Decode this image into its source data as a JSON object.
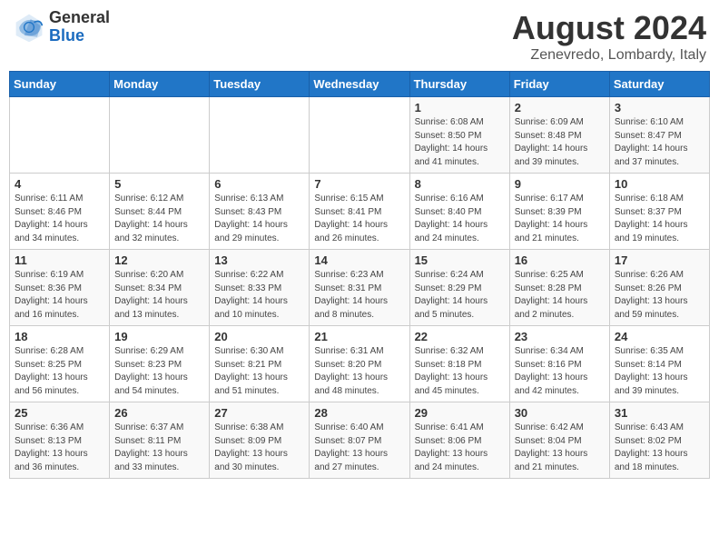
{
  "header": {
    "logo_general": "General",
    "logo_blue": "Blue",
    "main_title": "August 2024",
    "sub_title": "Zenevredo, Lombardy, Italy"
  },
  "days_of_week": [
    "Sunday",
    "Monday",
    "Tuesday",
    "Wednesday",
    "Thursday",
    "Friday",
    "Saturday"
  ],
  "weeks": [
    [
      {
        "day": "",
        "sunrise": "",
        "sunset": "",
        "daylight": ""
      },
      {
        "day": "",
        "sunrise": "",
        "sunset": "",
        "daylight": ""
      },
      {
        "day": "",
        "sunrise": "",
        "sunset": "",
        "daylight": ""
      },
      {
        "day": "",
        "sunrise": "",
        "sunset": "",
        "daylight": ""
      },
      {
        "day": "1",
        "sunrise": "6:08 AM",
        "sunset": "8:50 PM",
        "daylight": "14 hours and 41 minutes."
      },
      {
        "day": "2",
        "sunrise": "6:09 AM",
        "sunset": "8:48 PM",
        "daylight": "14 hours and 39 minutes."
      },
      {
        "day": "3",
        "sunrise": "6:10 AM",
        "sunset": "8:47 PM",
        "daylight": "14 hours and 37 minutes."
      }
    ],
    [
      {
        "day": "4",
        "sunrise": "6:11 AM",
        "sunset": "8:46 PM",
        "daylight": "14 hours and 34 minutes."
      },
      {
        "day": "5",
        "sunrise": "6:12 AM",
        "sunset": "8:44 PM",
        "daylight": "14 hours and 32 minutes."
      },
      {
        "day": "6",
        "sunrise": "6:13 AM",
        "sunset": "8:43 PM",
        "daylight": "14 hours and 29 minutes."
      },
      {
        "day": "7",
        "sunrise": "6:15 AM",
        "sunset": "8:41 PM",
        "daylight": "14 hours and 26 minutes."
      },
      {
        "day": "8",
        "sunrise": "6:16 AM",
        "sunset": "8:40 PM",
        "daylight": "14 hours and 24 minutes."
      },
      {
        "day": "9",
        "sunrise": "6:17 AM",
        "sunset": "8:39 PM",
        "daylight": "14 hours and 21 minutes."
      },
      {
        "day": "10",
        "sunrise": "6:18 AM",
        "sunset": "8:37 PM",
        "daylight": "14 hours and 19 minutes."
      }
    ],
    [
      {
        "day": "11",
        "sunrise": "6:19 AM",
        "sunset": "8:36 PM",
        "daylight": "14 hours and 16 minutes."
      },
      {
        "day": "12",
        "sunrise": "6:20 AM",
        "sunset": "8:34 PM",
        "daylight": "14 hours and 13 minutes."
      },
      {
        "day": "13",
        "sunrise": "6:22 AM",
        "sunset": "8:33 PM",
        "daylight": "14 hours and 10 minutes."
      },
      {
        "day": "14",
        "sunrise": "6:23 AM",
        "sunset": "8:31 PM",
        "daylight": "14 hours and 8 minutes."
      },
      {
        "day": "15",
        "sunrise": "6:24 AM",
        "sunset": "8:29 PM",
        "daylight": "14 hours and 5 minutes."
      },
      {
        "day": "16",
        "sunrise": "6:25 AM",
        "sunset": "8:28 PM",
        "daylight": "14 hours and 2 minutes."
      },
      {
        "day": "17",
        "sunrise": "6:26 AM",
        "sunset": "8:26 PM",
        "daylight": "13 hours and 59 minutes."
      }
    ],
    [
      {
        "day": "18",
        "sunrise": "6:28 AM",
        "sunset": "8:25 PM",
        "daylight": "13 hours and 56 minutes."
      },
      {
        "day": "19",
        "sunrise": "6:29 AM",
        "sunset": "8:23 PM",
        "daylight": "13 hours and 54 minutes."
      },
      {
        "day": "20",
        "sunrise": "6:30 AM",
        "sunset": "8:21 PM",
        "daylight": "13 hours and 51 minutes."
      },
      {
        "day": "21",
        "sunrise": "6:31 AM",
        "sunset": "8:20 PM",
        "daylight": "13 hours and 48 minutes."
      },
      {
        "day": "22",
        "sunrise": "6:32 AM",
        "sunset": "8:18 PM",
        "daylight": "13 hours and 45 minutes."
      },
      {
        "day": "23",
        "sunrise": "6:34 AM",
        "sunset": "8:16 PM",
        "daylight": "13 hours and 42 minutes."
      },
      {
        "day": "24",
        "sunrise": "6:35 AM",
        "sunset": "8:14 PM",
        "daylight": "13 hours and 39 minutes."
      }
    ],
    [
      {
        "day": "25",
        "sunrise": "6:36 AM",
        "sunset": "8:13 PM",
        "daylight": "13 hours and 36 minutes."
      },
      {
        "day": "26",
        "sunrise": "6:37 AM",
        "sunset": "8:11 PM",
        "daylight": "13 hours and 33 minutes."
      },
      {
        "day": "27",
        "sunrise": "6:38 AM",
        "sunset": "8:09 PM",
        "daylight": "13 hours and 30 minutes."
      },
      {
        "day": "28",
        "sunrise": "6:40 AM",
        "sunset": "8:07 PM",
        "daylight": "13 hours and 27 minutes."
      },
      {
        "day": "29",
        "sunrise": "6:41 AM",
        "sunset": "8:06 PM",
        "daylight": "13 hours and 24 minutes."
      },
      {
        "day": "30",
        "sunrise": "6:42 AM",
        "sunset": "8:04 PM",
        "daylight": "13 hours and 21 minutes."
      },
      {
        "day": "31",
        "sunrise": "6:43 AM",
        "sunset": "8:02 PM",
        "daylight": "13 hours and 18 minutes."
      }
    ]
  ],
  "labels": {
    "sunrise": "Sunrise:",
    "sunset": "Sunset:",
    "daylight": "Daylight:"
  }
}
